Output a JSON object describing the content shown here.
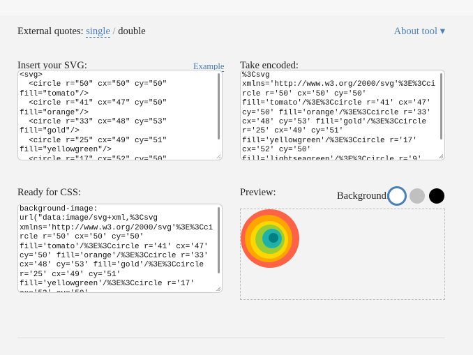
{
  "quotes": {
    "label": "External quotes:",
    "single": "single",
    "separator": "/",
    "double": "double"
  },
  "about_label": "About tool ▾",
  "input": {
    "label": "Insert your SVG:",
    "example_label": "Example",
    "value": "<svg>\n  <circle r=\"50\" cx=\"50\" cy=\"50\" fill=\"tomato\"/>\n  <circle r=\"41\" cx=\"47\" cy=\"50\" fill=\"orange\"/>\n  <circle r=\"33\" cx=\"48\" cy=\"53\" fill=\"gold\"/>\n  <circle r=\"25\" cx=\"49\" cy=\"51\" fill=\"yellowgreen\"/>\n  <circle r=\"17\" cx=\"52\" cy=\"50\""
  },
  "encoded": {
    "label": "Take encoded:",
    "value": "%3Csvg xmlns='http://www.w3.org/2000/svg'%3E%3Ccircle r='50' cx='50' cy='50' fill='tomato'/%3E%3Ccircle r='41' cx='47' cy='50' fill='orange'/%3E%3Ccircle r='33' cx='48' cy='53' fill='gold'/%3E%3Ccircle r='25' cx='49' cy='51' fill='yellowgreen'/%3E%3Ccircle r='17' cx='52' cy='50' fill='lightseagreen'/%3E%3Ccircle r='9'"
  },
  "css": {
    "label": "Ready for CSS:",
    "value": "background-image: url(\"data:image/svg+xml,%3Csvg xmlns='http://www.w3.org/2000/svg'%3E%3Ccircle r='50' cx='50' cy='50' fill='tomato'/%3E%3Ccircle r='41' cx='47' cy='50' fill='orange'/%3E%3Ccircle r='33' cx='48' cy='53' fill='gold'/%3E%3Ccircle r='25' cx='49' cy='51' fill='yellowgreen'/%3E%3Ccircle r='17' cx='52' cy='50'"
  },
  "preview": {
    "label": "Preview:",
    "background_label": "Background:",
    "swatches": [
      "#ffffff",
      "#c0c0c0",
      "#000000"
    ],
    "selected_swatch_border": "#4a7fb5",
    "circles": [
      "tomato",
      "orange",
      "gold",
      "yellowgreen",
      "lightseagreen",
      "teal"
    ]
  }
}
